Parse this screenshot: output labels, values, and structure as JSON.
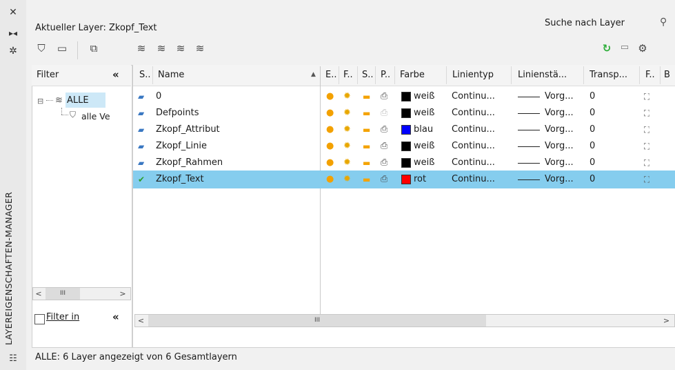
{
  "strip": {
    "title": "LAYEREIGENSCHAFTEN-MANAGER",
    "buttons": [
      "close-icon",
      "pin-icon",
      "settings-icon"
    ]
  },
  "current_layer": "Aktueller Layer: Zkopf_Text",
  "search": {
    "placeholder": "Suche nach Layer"
  },
  "toolbar": {
    "left": [
      "new-property-filter-icon",
      "new-group-filter-icon",
      "layer-states-manager-icon"
    ],
    "middle": [
      "new-layer-icon",
      "new-layer-vp-frozen-icon",
      "delete-layer-icon",
      "set-current-icon"
    ],
    "right": [
      "refresh-icon",
      "apply-icon",
      "settings-icon"
    ]
  },
  "filter": {
    "header": "Filter",
    "collapse": "«",
    "tree": [
      {
        "label": "ALLE",
        "selected": true,
        "expand": "⊟"
      },
      {
        "label": "alle Ve"
      }
    ],
    "filter_invert_label": "Filter in",
    "filter_invert_checked": false,
    "invert_collapse": "«"
  },
  "columns": [
    "S..",
    "Name",
    "E..",
    "F..",
    "S..",
    "P..",
    "Farbe",
    "Linientyp",
    "Linienstä...",
    "Transp...",
    "F..",
    "B"
  ],
  "sort_arrow": "▲",
  "layers": [
    {
      "name": "0",
      "color_name": "weiß",
      "color": "#000000",
      "linetype": "Continu...",
      "lineweight": "Vorg...",
      "transparency": "0",
      "current": false,
      "selected": false,
      "print_off": false
    },
    {
      "name": "Defpoints",
      "color_name": "weiß",
      "color": "#000000",
      "linetype": "Continu...",
      "lineweight": "Vorg...",
      "transparency": "0",
      "current": false,
      "selected": false,
      "print_off": true
    },
    {
      "name": "Zkopf_Attribut",
      "color_name": "blau",
      "color": "#0000ff",
      "linetype": "Continu...",
      "lineweight": "Vorg...",
      "transparency": "0",
      "current": false,
      "selected": false,
      "print_off": false
    },
    {
      "name": "Zkopf_Linie",
      "color_name": "weiß",
      "color": "#000000",
      "linetype": "Continu...",
      "lineweight": "Vorg...",
      "transparency": "0",
      "current": false,
      "selected": false,
      "print_off": false
    },
    {
      "name": "Zkopf_Rahmen",
      "color_name": "weiß",
      "color": "#000000",
      "linetype": "Continu...",
      "lineweight": "Vorg...",
      "transparency": "0",
      "current": false,
      "selected": false,
      "print_off": false
    },
    {
      "name": "Zkopf_Text",
      "color_name": "rot",
      "color": "#ff0000",
      "linetype": "Continu...",
      "lineweight": "Vorg...",
      "transparency": "0",
      "current": true,
      "selected": true,
      "print_off": false
    }
  ],
  "scroll": {
    "left": "<",
    "right": ">",
    "thumb": "III"
  },
  "status": "ALLE: 6 Layer angezeigt von 6 Gesamtlayern",
  "colors": {
    "selection": "#85cdee",
    "tree_selection": "#cde8f7",
    "refresh": "#2eae3a"
  }
}
